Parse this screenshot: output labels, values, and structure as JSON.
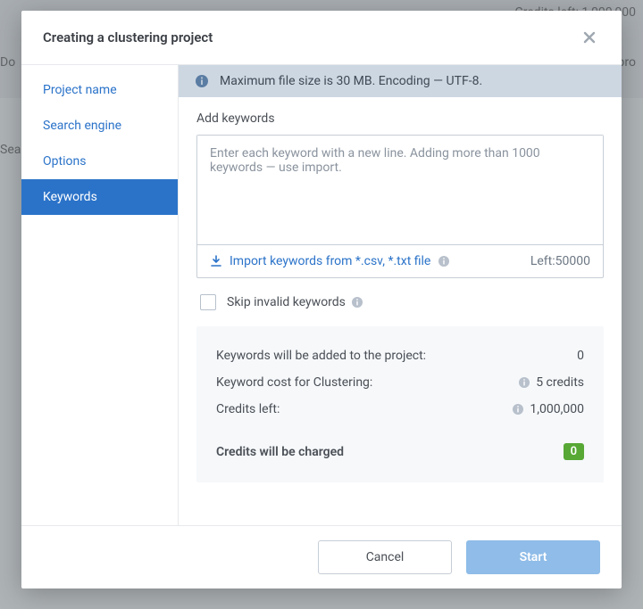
{
  "backdrop": {
    "credits_text": "Credits left: 1,000,000",
    "left_text_1": "Do",
    "left_text_2": "Sea",
    "right_text": "pro"
  },
  "modal": {
    "title": "Creating a clustering project",
    "tabs": [
      {
        "label": "Project name"
      },
      {
        "label": "Search engine"
      },
      {
        "label": "Options"
      },
      {
        "label": "Keywords"
      }
    ],
    "info_bar": "Maximum file size is 30 MB. Encoding — UTF-8.",
    "keywords": {
      "section_label": "Add keywords",
      "placeholder": "Enter each keyword with a new line. Adding more than 1000 keywords — use import.",
      "import_label": "Import keywords from *.csv, *.txt file",
      "left_label": "Left:50000"
    },
    "skip": {
      "label": "Skip invalid keywords"
    },
    "summary": {
      "rows": [
        {
          "label": "Keywords will be added to the project:",
          "value": "0",
          "info": false
        },
        {
          "label": "Keyword cost for Clustering:",
          "value": "5 credits",
          "info": true
        },
        {
          "label": "Credits left:",
          "value": "1,000,000",
          "info": true
        }
      ],
      "charge_label": "Credits will be charged",
      "charge_value": "0"
    },
    "footer": {
      "cancel": "Cancel",
      "start": "Start"
    }
  }
}
